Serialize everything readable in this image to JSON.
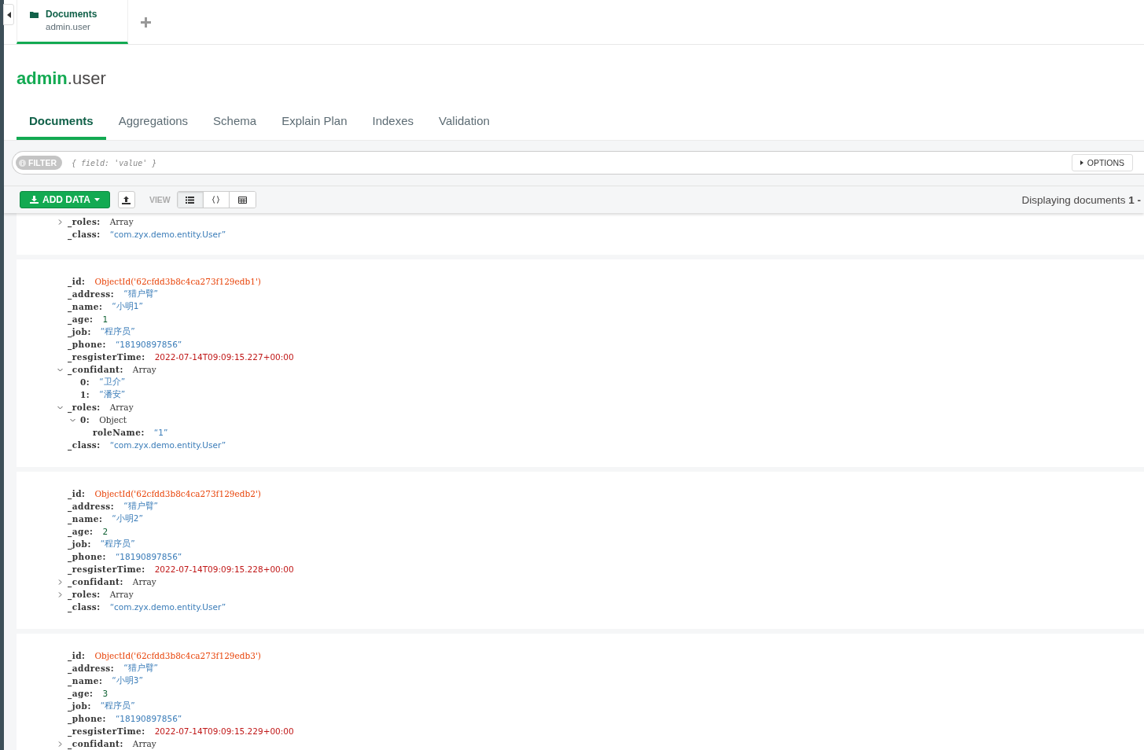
{
  "workspace_tabs": [
    {
      "title": "Documents",
      "subtitle": "admin.user",
      "selected": true
    }
  ],
  "namespace": {
    "database": "admin",
    "collection": ".user"
  },
  "tabs": [
    {
      "label": "Documents",
      "selected": true
    },
    {
      "label": "Aggregations",
      "selected": false
    },
    {
      "label": "Schema",
      "selected": false
    },
    {
      "label": "Explain Plan",
      "selected": false
    },
    {
      "label": "Indexes",
      "selected": false
    },
    {
      "label": "Validation",
      "selected": false
    }
  ],
  "filter": {
    "label": "FILTER",
    "placeholder": "{ field: 'value' }",
    "options_button": "OPTIONS"
  },
  "toolbar": {
    "add_data": "ADD DATA",
    "view_label": "VIEW",
    "views": [
      {
        "kind": "list",
        "selected": true
      },
      {
        "kind": "json",
        "selected": false
      },
      {
        "kind": "table",
        "selected": false
      }
    ],
    "displaying": "Displaying documents **1 -**"
  },
  "documents": [
    {
      "fields": [
        {
          "key": "_roles:",
          "kind": "array",
          "value": "Array",
          "expanded": false
        },
        {
          "key": "_class:",
          "kind": "string",
          "value": "“com.zyx.demo.entity.User”"
        }
      ]
    },
    {
      "fields": [
        {
          "key": "_id:",
          "kind": "objectid",
          "value": "ObjectId('62cfdd3b8c4ca273f129edb1')"
        },
        {
          "key": "_address:",
          "kind": "string",
          "value": "“猎户臂”"
        },
        {
          "key": "_name:",
          "kind": "string",
          "value": "“小明1”"
        },
        {
          "key": "_age:",
          "kind": "number",
          "value": "1"
        },
        {
          "key": "_job:",
          "kind": "string",
          "value": "“程序员”"
        },
        {
          "key": "_phone:",
          "kind": "string",
          "value": "“18190897856”"
        },
        {
          "key": "_resgisterTime:",
          "kind": "date",
          "value": "2022-07-14T09:09:15.227+00:00"
        },
        {
          "key": "_confidant:",
          "kind": "array",
          "value": "Array",
          "expanded": true,
          "children": [
            {
              "key": "0:",
              "kind": "string",
              "value": "“卫介”"
            },
            {
              "key": "1:",
              "kind": "string",
              "value": "“潘安”"
            }
          ]
        },
        {
          "key": "_roles:",
          "kind": "array",
          "value": "Array",
          "expanded": true,
          "children": [
            {
              "key": "0:",
              "kind": "object",
              "value": "Object",
              "expanded": true,
              "children": [
                {
                  "key": "roleName:",
                  "kind": "string",
                  "value": "“1”"
                }
              ]
            }
          ]
        },
        {
          "key": "_class:",
          "kind": "string",
          "value": "“com.zyx.demo.entity.User”"
        }
      ]
    },
    {
      "fields": [
        {
          "key": "_id:",
          "kind": "objectid",
          "value": "ObjectId('62cfdd3b8c4ca273f129edb2')"
        },
        {
          "key": "_address:",
          "kind": "string",
          "value": "“猎户臂”"
        },
        {
          "key": "_name:",
          "kind": "string",
          "value": "“小明2”"
        },
        {
          "key": "_age:",
          "kind": "number",
          "value": "2"
        },
        {
          "key": "_job:",
          "kind": "string",
          "value": "“程序员”"
        },
        {
          "key": "_phone:",
          "kind": "string",
          "value": "“18190897856”"
        },
        {
          "key": "_resgisterTime:",
          "kind": "date",
          "value": "2022-07-14T09:09:15.228+00:00"
        },
        {
          "key": "_confidant:",
          "kind": "array",
          "value": "Array",
          "expanded": false
        },
        {
          "key": "_roles:",
          "kind": "array",
          "value": "Array",
          "expanded": false
        },
        {
          "key": "_class:",
          "kind": "string",
          "value": "“com.zyx.demo.entity.User”"
        }
      ]
    },
    {
      "fields": [
        {
          "key": "_id:",
          "kind": "objectid",
          "value": "ObjectId('62cfdd3b8c4ca273f129edb3')"
        },
        {
          "key": "_address:",
          "kind": "string",
          "value": "“猎户臂”"
        },
        {
          "key": "_name:",
          "kind": "string",
          "value": "“小明3”"
        },
        {
          "key": "_age:",
          "kind": "number",
          "value": "3"
        },
        {
          "key": "_job:",
          "kind": "string",
          "value": "“程序员”"
        },
        {
          "key": "_phone:",
          "kind": "string",
          "value": "“18190897856”"
        },
        {
          "key": "_resgisterTime:",
          "kind": "date",
          "value": "2022-07-14T09:09:15.229+00:00"
        },
        {
          "key": "_confidant:",
          "kind": "array",
          "value": "Array",
          "expanded": false
        }
      ]
    }
  ]
}
